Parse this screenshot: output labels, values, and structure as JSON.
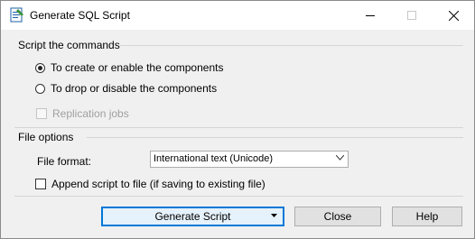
{
  "window": {
    "title": "Generate SQL Script"
  },
  "script_group": {
    "header": "Script the commands",
    "options": [
      {
        "label": "To create or enable the components",
        "selected": true
      },
      {
        "label": "To drop or disable the components",
        "selected": false
      }
    ],
    "replication_jobs": {
      "label": "Replication jobs",
      "checked": false,
      "enabled": false
    }
  },
  "file_options": {
    "header": "File options",
    "format_label": "File format:",
    "format_value": "International text (Unicode)",
    "append": {
      "label": "Append script to file (if saving to existing file)",
      "checked": false
    }
  },
  "buttons": {
    "generate": "Generate Script",
    "close": "Close",
    "help": "Help"
  },
  "colors": {
    "accent": "#0078d7",
    "client_bg": "#f0f0f0"
  }
}
